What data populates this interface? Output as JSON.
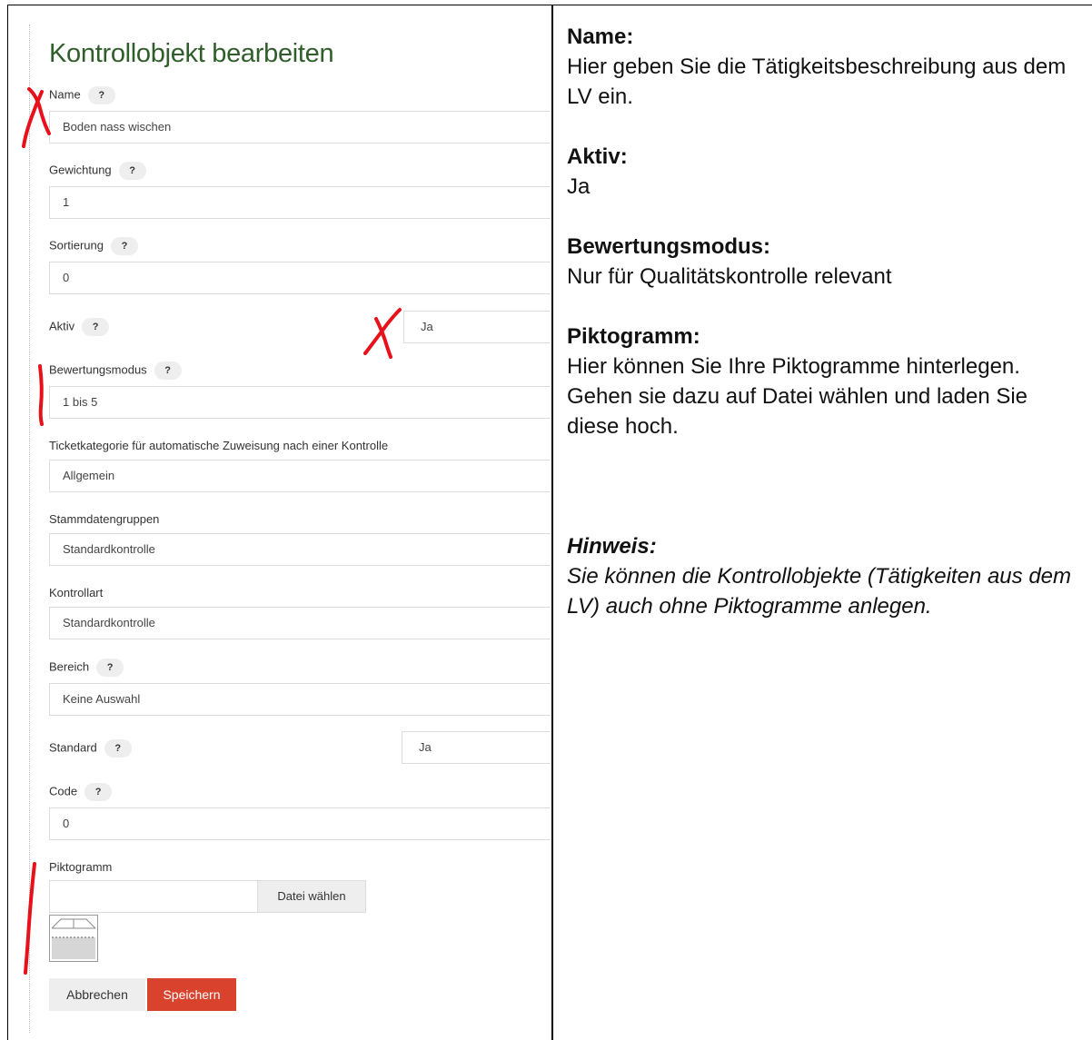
{
  "form": {
    "title": "Kontrollobjekt bearbeiten",
    "help_symbol": "?",
    "fields": {
      "name": {
        "label": "Name",
        "value": "Boden nass wischen"
      },
      "gewichtung": {
        "label": "Gewichtung",
        "value": "1"
      },
      "sortierung": {
        "label": "Sortierung",
        "value": "0"
      },
      "aktiv": {
        "label": "Aktiv",
        "value": "Ja"
      },
      "bewertungsmodus": {
        "label": "Bewertungsmodus",
        "value": "1 bis 5"
      },
      "ticketkategorie": {
        "label": "Ticketkategorie für automatische Zuweisung nach einer Kontrolle",
        "value": "Allgemein"
      },
      "stammdatengruppen": {
        "label": "Stammdatengruppen",
        "value": "Standardkontrolle"
      },
      "kontrollart": {
        "label": "Kontrollart",
        "value": "Standardkontrolle"
      },
      "bereich": {
        "label": "Bereich",
        "value": "Keine Auswahl"
      },
      "standard": {
        "label": "Standard",
        "value": "Ja"
      },
      "code": {
        "label": "Code",
        "value": "0"
      },
      "piktogramm": {
        "label": "Piktogramm",
        "file_button": "Datei wählen"
      }
    },
    "buttons": {
      "cancel": "Abbrechen",
      "save": "Speichern"
    },
    "colors": {
      "title": "#2f5e2a",
      "save": "#d9432e",
      "annotation": "#e8101a"
    }
  },
  "notes": {
    "name": {
      "heading": "Name:",
      "text": "Hier geben Sie die Tätigkeitsbeschreibung aus dem LV ein."
    },
    "aktiv": {
      "heading": "Aktiv:",
      "text": "Ja"
    },
    "bewertungsmodus": {
      "heading": "Bewertungsmodus:",
      "text": "Nur für Qualitätskontrolle relevant"
    },
    "piktogramm": {
      "heading": "Piktogramm:",
      "text": "Hier können Sie Ihre Piktogramme hinterlegen. Gehen sie dazu auf Datei wählen und laden Sie diese hoch."
    },
    "hinweis": {
      "heading": "Hinweis:",
      "text": "Sie können die Kontrollobjekte (Tätigkeiten aus dem LV) auch ohne Piktogramme anlegen."
    }
  }
}
